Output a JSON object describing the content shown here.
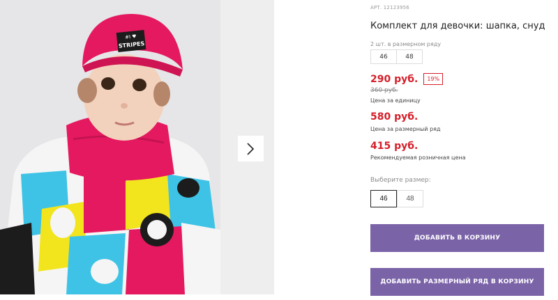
{
  "gallery": {
    "next_icon": "chevron-right-icon",
    "hat_text_line1": "#I ♥",
    "hat_text_line2": "STRIPES"
  },
  "product": {
    "article": "АРТ. 12123956",
    "title": "Комплект для девочки: шапка, снуд",
    "pack_note": "2 шт. в размерном ряду",
    "pack_sizes": [
      "46",
      "48"
    ],
    "price": "290 руб.",
    "discount": "19%",
    "old_price": "360 руб.",
    "unit_caption": "Цена за единицу",
    "row_price": "580 руб.",
    "row_caption": "Цена за размерный ряд",
    "retail_price": "415 руб.",
    "retail_caption": "Рекомендуемая розничная цена",
    "size_label": "Выберите размер:",
    "sizes": [
      "46",
      "48"
    ],
    "selected_size": "46",
    "add_to_cart": "ДОБАВИТЬ В КОРЗИНУ",
    "add_row_to_cart": "ДОБАВИТЬ РАЗМЕРНЫЙ РЯД В КОРЗИНУ"
  },
  "colors": {
    "accent": "#7b63a8",
    "price_red": "#d51f2a",
    "hat_pink": "#e5195f"
  }
}
